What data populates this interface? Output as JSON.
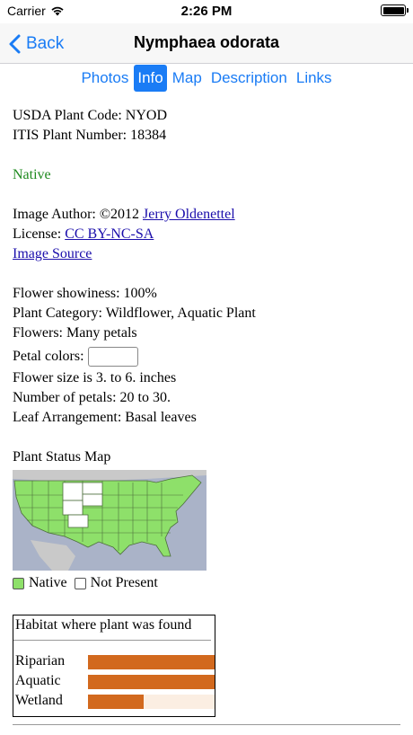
{
  "status_bar": {
    "carrier": "Carrier",
    "time": "2:26 PM"
  },
  "nav": {
    "back_label": "Back",
    "title": "Nymphaea odorata"
  },
  "tabs": [
    {
      "label": "Photos",
      "active": false
    },
    {
      "label": "Info",
      "active": true
    },
    {
      "label": "Map",
      "active": false
    },
    {
      "label": "Description",
      "active": false
    },
    {
      "label": "Links",
      "active": false
    }
  ],
  "info": {
    "usda_code": "USDA Plant Code: NYOD",
    "itis_number": "ITIS Plant Number: 18384",
    "native": "Native",
    "image_author_prefix": "Image Author: ©2012 ",
    "image_author_name": "Jerry Oldenettel",
    "license_prefix": "License: ",
    "license_name": "CC BY-NC-SA",
    "image_source": "Image Source",
    "showiness": "Flower showiness: 100%",
    "category": "Plant Category: Wildflower, Aquatic Plant",
    "flowers": "Flowers: Many petals",
    "petal_colors": "Petal colors:",
    "flower_size": "Flower size is 3. to 6. inches",
    "petal_count": "Number of petals: 20 to 30.",
    "leaf_arrangement": "Leaf Arrangement: Basal leaves",
    "status_map_title": "Plant Status Map"
  },
  "legend": {
    "native": "Native",
    "not_present": "Not Present",
    "native_color": "#8ee06a",
    "not_present_color": "#ffffff"
  },
  "habitat": {
    "title": "Habitat where plant was found",
    "bar_color": "#d2691e",
    "rows": [
      {
        "label": "Riparian",
        "fraction": 1.0
      },
      {
        "label": "Aquatic",
        "fraction": 1.0
      },
      {
        "label": "Wetland",
        "fraction": 0.44
      }
    ]
  }
}
